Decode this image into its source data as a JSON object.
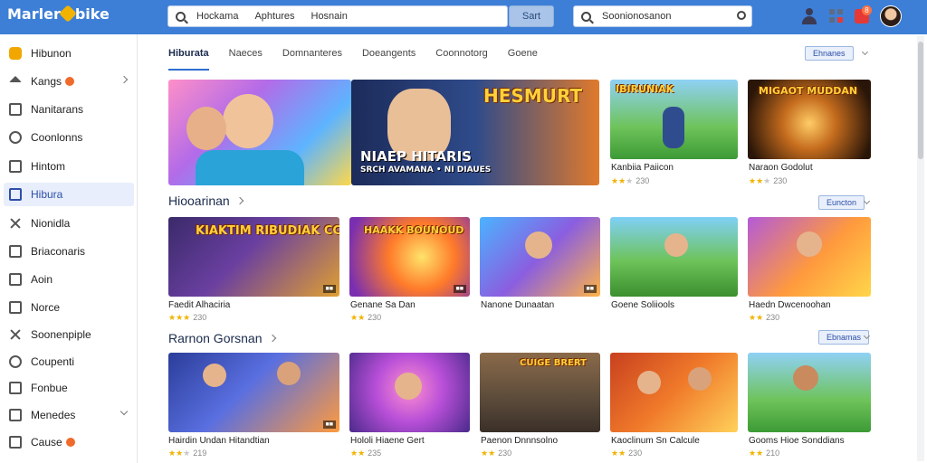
{
  "app": {
    "logo_text_left": "Marler",
    "logo_text_right": "bike"
  },
  "search": {
    "tokens": [
      "Hockama",
      "Aphtures",
      "Hosnain"
    ],
    "button_label": "Sart",
    "secondary_placeholder": "Soonionosanon"
  },
  "header_icons": [
    "people-icon",
    "grid-icon",
    "notification-icon",
    "user-avatar"
  ],
  "notification_count": "8",
  "sidebar": {
    "items": [
      {
        "label": "Hibunon",
        "icon": "app-logo-icon"
      },
      {
        "label": "Kangs",
        "icon": "home-icon",
        "badge": true,
        "chevron": "right"
      },
      {
        "label": "Nanitarans",
        "icon": "bookmark-icon"
      },
      {
        "label": "Coonlonns",
        "icon": "chat-icon"
      },
      {
        "label": "Hintom",
        "icon": "list-icon"
      },
      {
        "label": "Hibura",
        "icon": "chart-icon",
        "active": true
      },
      {
        "label": "Nionidla",
        "icon": "tools-icon"
      },
      {
        "label": "Briaconaris",
        "icon": "briefcase-icon"
      },
      {
        "label": "Aoin",
        "icon": "edit-icon"
      },
      {
        "label": "Norce",
        "icon": "document-icon"
      },
      {
        "label": "Soonenpiple",
        "icon": "cross-icon"
      },
      {
        "label": "Coupenti",
        "icon": "disc-icon"
      },
      {
        "label": "Fonbue",
        "icon": "check-icon"
      },
      {
        "label": "Menedes",
        "icon": "check-icon",
        "chevron": "down"
      },
      {
        "label": "Cause",
        "icon": "close-box-icon",
        "badge": true
      }
    ]
  },
  "tabs": [
    "Hiburata",
    "Naeces",
    "Domnanteres",
    "Doeangents",
    "Coonnotorg",
    "Goene"
  ],
  "active_tab": "Hiburata",
  "top_chip": "Ehnanes",
  "featured": [
    {
      "banner": "HESMURT",
      "subtitle": "NIAEP HITARIS",
      "caption": "SRCH AVAMANA • NI DIAUES"
    },
    {
      "title": "Kanbiia Paiicon",
      "rating_label": "230",
      "stars": 2,
      "image_text": "IBIRUNIAK"
    },
    {
      "title": "Naraon Godolut",
      "rating_label": "230",
      "stars": 2,
      "image_text": "MIGAOT MUDDAN"
    }
  ],
  "sections": [
    {
      "title": "Hiooarinan",
      "chip": "Euncton",
      "games": [
        {
          "title": "Faedit Alhaciria",
          "rating": "230",
          "stars": 3,
          "image_text": "KIAKTIM RIBUDIAK CCADIS"
        },
        {
          "title": "Genane Sa Dan",
          "rating": "230",
          "stars": 2,
          "image_text": "HAAKK BOUNOUD"
        },
        {
          "title": "Nanone Dunaatan",
          "rating": "",
          "stars": 0
        },
        {
          "title": "Goene Soliiools",
          "rating": "",
          "stars": 0
        },
        {
          "title": "Haedn Dwcenoohan",
          "rating": "230",
          "stars": 2
        }
      ]
    },
    {
      "title": "Rarnon Gorsnan",
      "chip": "Ebnamas",
      "games": [
        {
          "title": "Hairdin Undan Hitandtian",
          "rating": "219",
          "stars": 2
        },
        {
          "title": "Hololi Hiaene Gert",
          "rating": "235",
          "stars": 2
        },
        {
          "title": "Paenon Dnnnsolno",
          "rating": "230",
          "stars": 2,
          "image_text": "CUIGE BRERT"
        },
        {
          "title": "Kaoclinum Sn Calcule",
          "rating": "230",
          "stars": 2
        },
        {
          "title": "Gooms Hioe Sonddians",
          "rating": "210",
          "stars": 2
        }
      ]
    }
  ]
}
